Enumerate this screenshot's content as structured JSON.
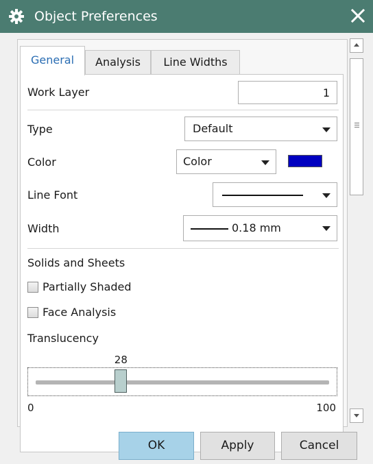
{
  "window": {
    "title": "Object Preferences",
    "icon": "gear-icon",
    "close_icon": "close-icon",
    "titlebar_color": "#4b7c71"
  },
  "tabs": [
    {
      "label": "General",
      "active": true
    },
    {
      "label": "Analysis",
      "active": false
    },
    {
      "label": "Line Widths",
      "active": false
    }
  ],
  "general": {
    "work_layer": {
      "label": "Work Layer",
      "value": "1"
    },
    "type": {
      "label": "Type",
      "value": "Default"
    },
    "color": {
      "label": "Color",
      "value": "Color",
      "swatch": "#0000c0"
    },
    "line_font": {
      "label": "Line Font",
      "value": "solid line"
    },
    "width": {
      "label": "Width",
      "value": "0.18 mm"
    },
    "solids_and_sheets": {
      "heading": "Solids and Sheets",
      "partially_shaded": {
        "label": "Partially Shaded",
        "checked": false
      },
      "face_analysis": {
        "label": "Face Analysis",
        "checked": false
      }
    },
    "translucency": {
      "label": "Translucency",
      "value": "28",
      "min": "0",
      "max": "100",
      "level": 28
    }
  },
  "buttons": {
    "ok": "OK",
    "apply": "Apply",
    "cancel": "Cancel"
  }
}
